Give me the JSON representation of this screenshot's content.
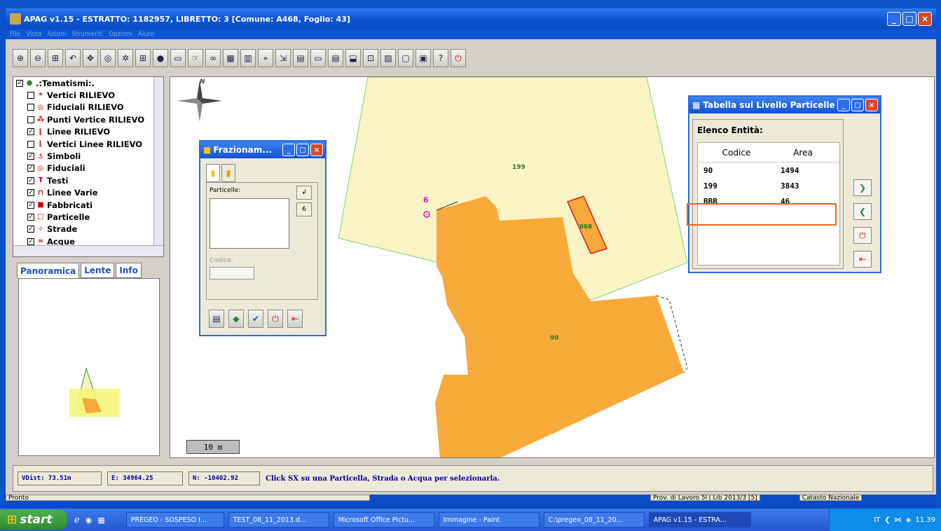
{
  "window": {
    "title": "APAG v1.15 - ESTRATTO: 1182957, LIBRETTO: 3 [Comune: A468, Foglio: 43]"
  },
  "menu": [
    "File",
    "Vista",
    "Azioni",
    "Strumenti",
    "Opzioni",
    "Aiuto"
  ],
  "toolbar_icons": [
    "zoom-in-icon",
    "zoom-out-icon",
    "zoom-window-icon",
    "zoom-prev-icon",
    "pan-icon",
    "measure-icon",
    "extent-icon",
    "grid-icon",
    "globe-icon",
    "layer-icon",
    "select-icon",
    "link-icon",
    "table-icon",
    "edit-icon",
    "snap-icon",
    "move-icon",
    "attach-icon",
    "save-icon",
    "export-icon",
    "import-icon",
    "calc-icon",
    "chart-icon",
    "copy-icon",
    "print-icon",
    "help-icon",
    "power-icon"
  ],
  "tree": {
    "root": ".:Tematismi:.",
    "items": [
      {
        "label": "Vertici RILIEVO",
        "checked": false,
        "icon": "*"
      },
      {
        "label": "Fiduciali RILIEVO",
        "checked": false,
        "icon": "◎"
      },
      {
        "label": "Punti Vertice RILIEVO",
        "checked": false,
        "icon": "⁂"
      },
      {
        "label": "Linee RILIEVO",
        "checked": true,
        "icon": "⌊"
      },
      {
        "label": "Vertici Linee RILIEVO",
        "checked": false,
        "icon": "⌊"
      },
      {
        "label": "Simboli",
        "checked": true,
        "icon": "⚓"
      },
      {
        "label": "Fiduciali",
        "checked": true,
        "icon": "◎"
      },
      {
        "label": "Testi",
        "checked": true,
        "icon": "T"
      },
      {
        "label": "Linee Varie",
        "checked": true,
        "icon": "⊓"
      },
      {
        "label": "Fabbricati",
        "checked": true,
        "icon": "■"
      },
      {
        "label": "Particelle",
        "checked": true,
        "icon": "□"
      },
      {
        "label": "Strade",
        "checked": true,
        "icon": "✧"
      },
      {
        "label": "Acque",
        "checked": true,
        "icon": "≈"
      }
    ]
  },
  "panel_tabs": [
    "Panoramica",
    "Lente",
    "Info"
  ],
  "map": {
    "labels": {
      "p199": "199",
      "p90": "90",
      "bbb": "BBB",
      "fid": "6"
    },
    "north": "N",
    "scale": "10 m"
  },
  "frazionamento": {
    "title": "Frazionam...",
    "particelle_label": "Particelle:",
    "codice_label": "Codice:",
    "btn6": "6"
  },
  "tabella": {
    "title": "Tabella sul Livello Particelle",
    "heading": "Elenco Entità:",
    "columns": [
      "Codice",
      "Area"
    ],
    "rows": [
      {
        "codice": "90",
        "area": "1494"
      },
      {
        "codice": "199",
        "area": "3843"
      },
      {
        "codice": "BBB",
        "area": "46"
      }
    ],
    "highlight_color": "#e8641e"
  },
  "status": {
    "vdist": "VDist: 73.51m",
    "e": "E: 34964.25",
    "n": "N: -10402.92",
    "message": "Click SX su una Particella, Strada o Acqua per selezionarla."
  },
  "prontobar": {
    "left": "Pronto",
    "prov": "Prov. di Lavoro 5I",
    "lib": "Lib 2013/3 [5]",
    "catasto": "Catasto Nazionale"
  },
  "taskbar": {
    "start": "start",
    "tasks": [
      "PREGEO - SOSPESO I...",
      "TEST_08_11_2013.d...",
      "Microsoft Office Pictu...",
      "Immagine - Paint",
      "C:\\pregeo_08_11_20...",
      "APAG v1.15 - ESTRA..."
    ],
    "lang": "IT",
    "clock": "11.39"
  },
  "colors": {
    "parcel_fill": "#faf3c4",
    "building_fill": "#f7a93a",
    "parcel_border": "#7bd47b",
    "bbb_border": "#d02020"
  }
}
